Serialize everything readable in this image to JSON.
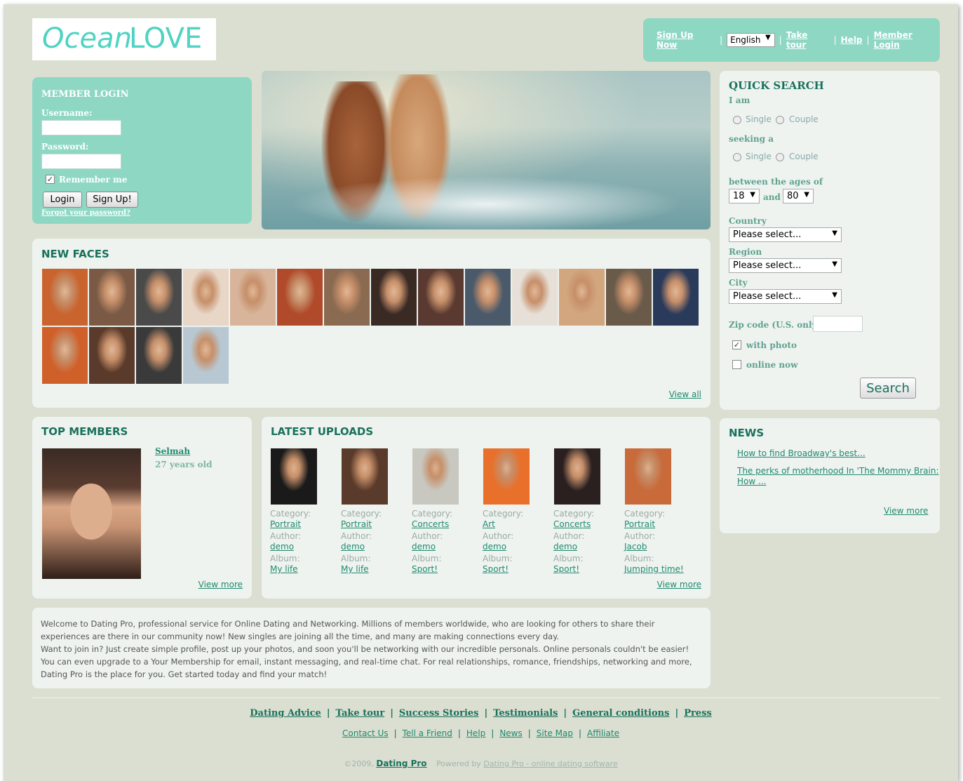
{
  "logo": {
    "part1": "Ocean",
    "part2": "LOVE"
  },
  "topnav": {
    "signup": "Sign Up Now",
    "language": "English",
    "take_tour": "Take tour",
    "help": "Help",
    "member_login": "Member Login",
    "separator": "|"
  },
  "login": {
    "title": "MEMBER LOGIN",
    "username_label": "Username:",
    "password_label": "Password:",
    "remember_label": "Remember me",
    "remember_checked": true,
    "login_button": "Login",
    "signup_button": "Sign Up!",
    "forgot": "Forgot your password?"
  },
  "new_faces": {
    "title": "NEW FACES",
    "view_all": "View all",
    "thumbs": [
      "#c9642e",
      "#7a5a45",
      "#4a4a4a",
      "#e8d6c6",
      "#d8b49a",
      "#b04a2a",
      "#8a6a50",
      "#3a2a24",
      "#5a3a30",
      "#4a5a6a",
      "#e6e0d8",
      "#d2a67e",
      "#6a5a4a",
      "#2a3a5a",
      "#d0602a",
      "#5a3a2a",
      "#3a3a3a",
      "#b8c8d2"
    ]
  },
  "quick_search": {
    "title": "QUICK SEARCH",
    "i_am": "I am",
    "single": "Single",
    "couple": "Couple",
    "seeking": "seeking a",
    "ages_label": "between the ages of",
    "age_from": "18",
    "and": "and",
    "age_to": "80",
    "country_label": "Country",
    "region_label": "Region",
    "city_label": "City",
    "please_select": "Please select...",
    "zip_label": "Zip code (U.S. only)",
    "with_photo": "with photo",
    "with_photo_checked": true,
    "online_now": "online now",
    "online_now_checked": false,
    "search_button": "Search"
  },
  "top_members": {
    "title": "TOP MEMBERS",
    "name": "Selmah",
    "age": "27 years old",
    "view_more": "View more"
  },
  "latest_uploads": {
    "title": "LATEST UPLOADS",
    "category_label": "Category:",
    "author_label": "Author:",
    "album_label": "Album:",
    "view_more": "View more",
    "items": [
      {
        "category": "Portrait",
        "author": "demo",
        "album": "My life",
        "color": "#1a1a1a"
      },
      {
        "category": "Portrait",
        "author": "demo",
        "album": "My life",
        "color": "#5a3a2a"
      },
      {
        "category": "Concerts",
        "author": "demo",
        "album": "Sport!",
        "color": "#c8c8c0"
      },
      {
        "category": "Art",
        "author": "demo",
        "album": "Sport!",
        "color": "#e8702a"
      },
      {
        "category": "Concerts",
        "author": "demo",
        "album": "Sport!",
        "color": "#2a2020"
      },
      {
        "category": "Portrait",
        "author": "Jacob",
        "album": "Jumping time!",
        "color": "#c86a3a"
      }
    ]
  },
  "news": {
    "title": "NEWS",
    "item1": "How to find Broadway's best...",
    "item2a": "The perks of motherhood In 'The Mommy Brain:",
    "item2b": "How ...",
    "view_more": "View more"
  },
  "welcome": {
    "line1": "Welcome to Dating Pro, professional service for Online Dating and Networking. Millions of members worldwide, who are looking for others to share their experiences are there in our community now! New singles are joining all the time, and many are making connections every day.",
    "line2": "Want to join in? Just create simple profile, post up your photos, and soon you'll be networking with our incredible personals. Online personals couldn't be easier! You can even upgrade to a Your Membership for email, instant messaging, and real-time chat. For real relationships, romance, friendships, networking and more, Dating Pro is the place for you. Get started today and find your match!"
  },
  "footer": {
    "links1": [
      "Dating Advice",
      "Take tour",
      "Success Stories",
      "Testimonials",
      "General conditions",
      "Press"
    ],
    "links2": [
      "Contact Us",
      "Tell a Friend",
      "Help",
      "News",
      "Site Map",
      "Affiliate"
    ],
    "copyright": "©2009,",
    "brand": "Dating Pro",
    "powered_by": "Powered by",
    "powered_link": "Dating Pro - online dating software"
  }
}
